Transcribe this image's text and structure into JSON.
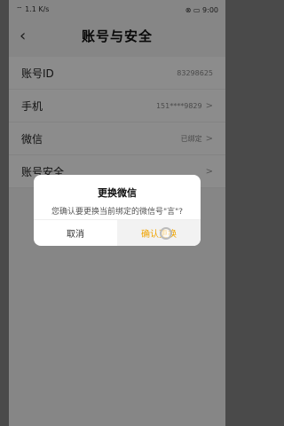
{
  "statusbar": {
    "left": "⌔ 1.1 K/s",
    "right": "⊗ ▭ 9:00"
  },
  "header": {
    "title": "账号与安全",
    "back_icon": "‹"
  },
  "rows": [
    {
      "label": "账号ID",
      "value": "83298625",
      "chevron": ""
    },
    {
      "label": "手机",
      "value": "151****9829",
      "chevron": ">"
    },
    {
      "label": "微信",
      "value": "已绑定",
      "chevron": ">"
    },
    {
      "label": "账号安全",
      "value": "",
      "chevron": ">"
    }
  ],
  "dialog": {
    "title": "更换微信",
    "message": "您确认要更换当前绑定的微信号\"言\"?",
    "cancel_label": "取消",
    "confirm_label": "确认更换"
  },
  "colors": {
    "accent": "#f0a400",
    "overlay": "rgba(0,0,0,0.45)"
  }
}
